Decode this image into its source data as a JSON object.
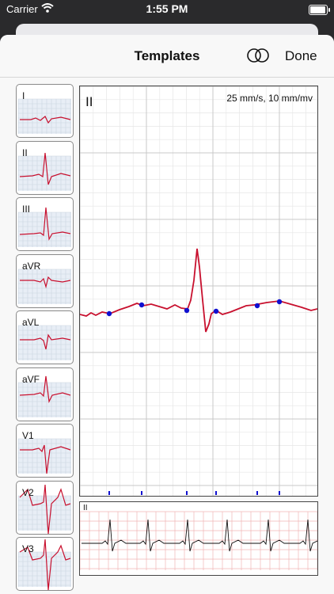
{
  "status_bar": {
    "carrier": "Carrier",
    "time": "1:55 PM",
    "battery_level": 1.0
  },
  "navbar": {
    "title": "Templates",
    "overlay_icon": "overlapping-circles-icon",
    "done_label": "Done"
  },
  "leads": [
    {
      "label": "I"
    },
    {
      "label": "II"
    },
    {
      "label": "III"
    },
    {
      "label": "aVR"
    },
    {
      "label": "aVL"
    },
    {
      "label": "aVF"
    },
    {
      "label": "V1"
    },
    {
      "label": "V2"
    },
    {
      "label": "V3"
    }
  ],
  "main_view": {
    "lead": "II",
    "scale_label": "25 mm/s, 10 mm/mv"
  },
  "rhythm_strip": {
    "lead": "II"
  },
  "colors": {
    "waveform": "#c8102e",
    "marker": "#1010d0",
    "grid_minor": "#e6e6e6",
    "grid_major": "#c8c8c8",
    "rhythm_grid": "#f1b5b5"
  }
}
